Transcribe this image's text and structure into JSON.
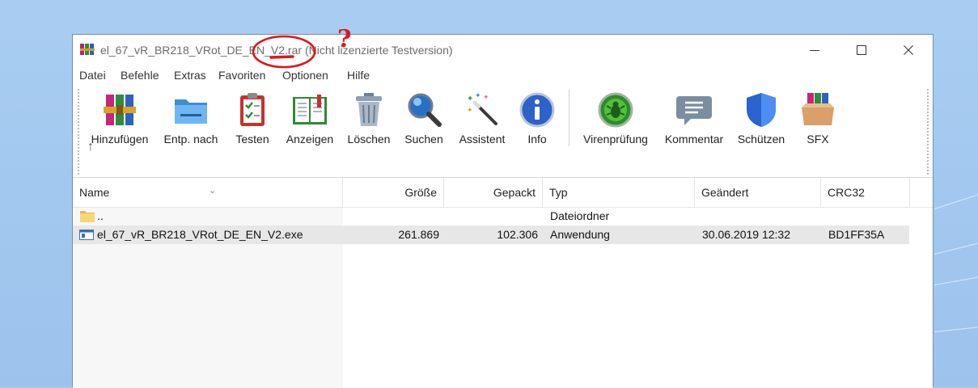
{
  "window": {
    "title_name": "el_67_vR_BR218_VRot_DE_EN_V2.rar",
    "title_status": "(Nicht lizenzierte Testversion)",
    "controls": [
      "minimize-icon",
      "maximize-icon",
      "close-icon"
    ]
  },
  "menu": [
    "Datei",
    "Befehle",
    "Extras",
    "Favoriten",
    "Optionen",
    "Hilfe"
  ],
  "toolbar": [
    {
      "label": "Hinzufügen",
      "icon": "add-archive-icon"
    },
    {
      "label": "Entp. nach",
      "icon": "extract-folder-icon"
    },
    {
      "label": "Testen",
      "icon": "test-clipboard-icon"
    },
    {
      "label": "Anzeigen",
      "icon": "view-book-icon"
    },
    {
      "label": "Löschen",
      "icon": "trash-icon"
    },
    {
      "label": "Suchen",
      "icon": "magnifier-icon"
    },
    {
      "label": "Assistent",
      "icon": "wizard-wand-icon"
    },
    {
      "label": "Info",
      "icon": "info-icon"
    },
    {
      "label": "Virenprüfung",
      "icon": "virus-scan-icon"
    },
    {
      "label": "Kommentar",
      "icon": "comment-icon"
    },
    {
      "label": "Schützen",
      "icon": "shield-icon"
    },
    {
      "label": "SFX",
      "icon": "sfx-box-icon"
    }
  ],
  "nav_up": "↑",
  "columns": [
    "Name",
    "Größe",
    "Gepackt",
    "Typ",
    "Geändert",
    "CRC32"
  ],
  "rows": [
    {
      "name": "..",
      "size": "",
      "packed": "",
      "type": "Dateiordner",
      "modified": "",
      "crc": ""
    },
    {
      "name": "el_67_vR_BR218_VRot_DE_EN_V2.exe",
      "size": "261.869",
      "packed": "102.306",
      "type": "Anwendung",
      "modified": "30.06.2019 12:32",
      "crc": "BD1FF35A"
    }
  ],
  "annotation": {
    "mark": "?",
    "color": "#e0161b"
  }
}
